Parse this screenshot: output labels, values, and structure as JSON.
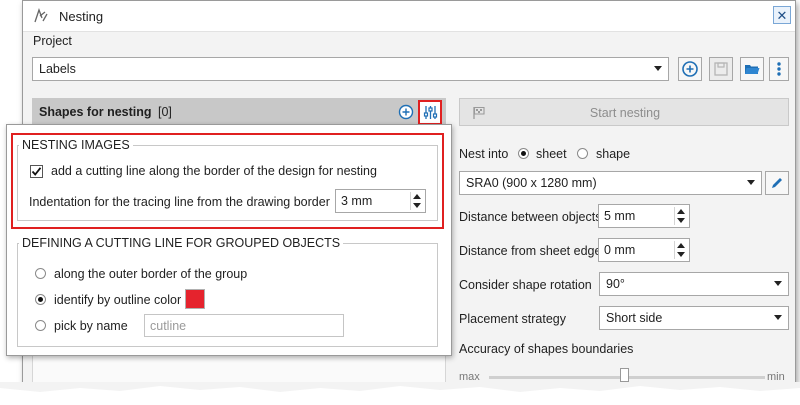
{
  "window": {
    "title": "Nesting",
    "close": "✕"
  },
  "project": {
    "label": "Project",
    "value": "Labels",
    "buttons": [
      "add-icon",
      "save-icon",
      "open-folder-icon",
      "more-icon"
    ]
  },
  "shapes": {
    "label": "Shapes for nesting",
    "count": "[0]"
  },
  "start_nesting": "Start nesting",
  "nest_into": {
    "label": "Nest into",
    "options": [
      "sheet",
      "shape"
    ],
    "selected": "sheet"
  },
  "sheet_size": "SRA0 (900 x 1280 mm)",
  "distance_objects": {
    "label": "Distance between objects",
    "value": "5 mm"
  },
  "distance_edge": {
    "label": "Distance from sheet edge",
    "value": "0 mm"
  },
  "rotation": {
    "label": "Consider shape rotation",
    "value": "90°"
  },
  "placement": {
    "label": "Placement strategy",
    "value": "Short side"
  },
  "accuracy": {
    "label": "Accuracy of shapes boundaries",
    "min_label": "max",
    "max_label": "min"
  },
  "nesting_images": {
    "title": "NESTING IMAGES",
    "checkbox_label": "add a cutting line along the border of the design for nesting",
    "checked": true,
    "indent_label": "Indentation for the tracing line from the drawing border",
    "indent_value": "3 mm"
  },
  "grouped": {
    "title": "DEFINING A CUTTING LINE FOR GROUPED OBJECTS",
    "options": [
      "along the outer border of the group",
      "identify by outline color",
      "pick by name"
    ],
    "selected": "identify by outline color",
    "outline_color": "#e5232d",
    "name_placeholder": "cutline"
  },
  "colors": {
    "highlight": "#e02020",
    "accent": "#1f6fb5"
  }
}
